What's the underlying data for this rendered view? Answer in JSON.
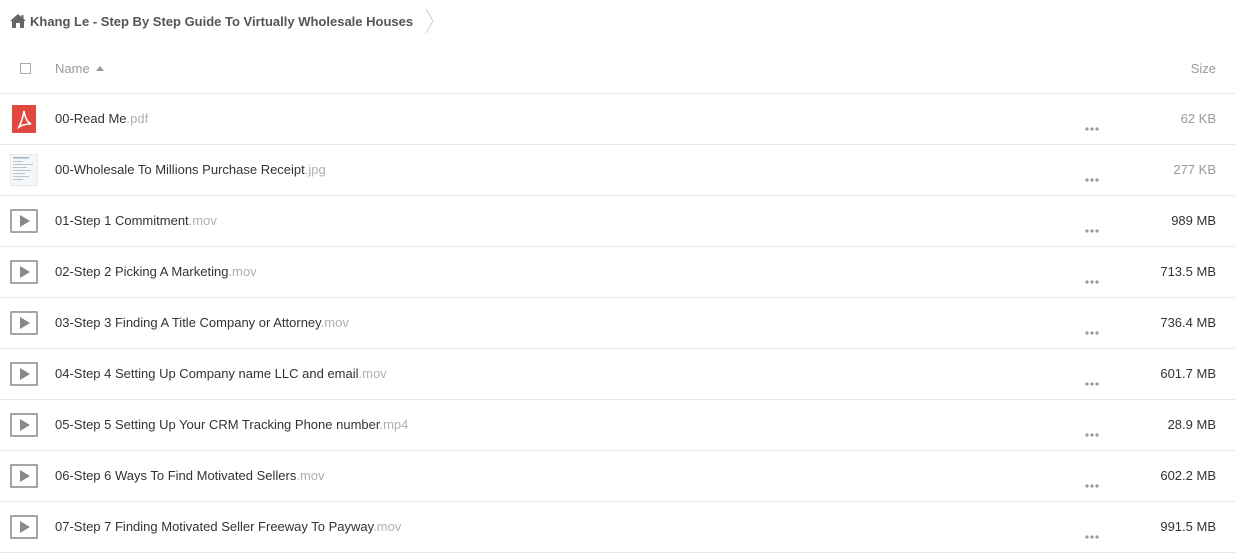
{
  "breadcrumb": {
    "folder_name": "Khang Le - Step By Step Guide To Virtually Wholesale Houses",
    "home_icon": "home-icon"
  },
  "header": {
    "name_label": "Name",
    "size_label": "Size",
    "sort_icon": "sort-ascending-icon"
  },
  "files": [
    {
      "name": "00-Read Me",
      "ext": ".pdf",
      "size": "62 KB",
      "icon": "pdf-icon"
    },
    {
      "name": "00-Wholesale To Millions Purchase Receipt",
      "ext": ".jpg",
      "size": "277 KB",
      "icon": "image-thumbnail"
    },
    {
      "name": "01-Step 1 Commitment",
      "ext": ".mov",
      "size": "989 MB",
      "icon": "video-icon"
    },
    {
      "name": "02-Step 2 Picking A Marketing",
      "ext": ".mov",
      "size": "713.5 MB",
      "icon": "video-icon"
    },
    {
      "name": "03-Step 3 Finding A Title Company or Attorney",
      "ext": ".mov",
      "size": "736.4 MB",
      "icon": "video-icon"
    },
    {
      "name": "04-Step 4 Setting Up Company name LLC and email",
      "ext": ".mov",
      "size": "601.7 MB",
      "icon": "video-icon"
    },
    {
      "name": "05-Step 5 Setting Up Your CRM Tracking Phone number",
      "ext": ".mp4",
      "size": "28.9 MB",
      "icon": "video-icon"
    },
    {
      "name": "06-Step 6 Ways To Find Motivated Sellers",
      "ext": ".mov",
      "size": "602.2 MB",
      "icon": "video-icon"
    },
    {
      "name": "07-Step 7 Finding Motivated Seller Freeway To Payway",
      "ext": ".mov",
      "size": "991.5 MB",
      "icon": "video-icon"
    }
  ],
  "colors": {
    "pdf_red": "#e0483e",
    "video_icon_gray": "#888888",
    "ext_gray": "#b0b0b0",
    "divider": "#e8e8e8"
  }
}
